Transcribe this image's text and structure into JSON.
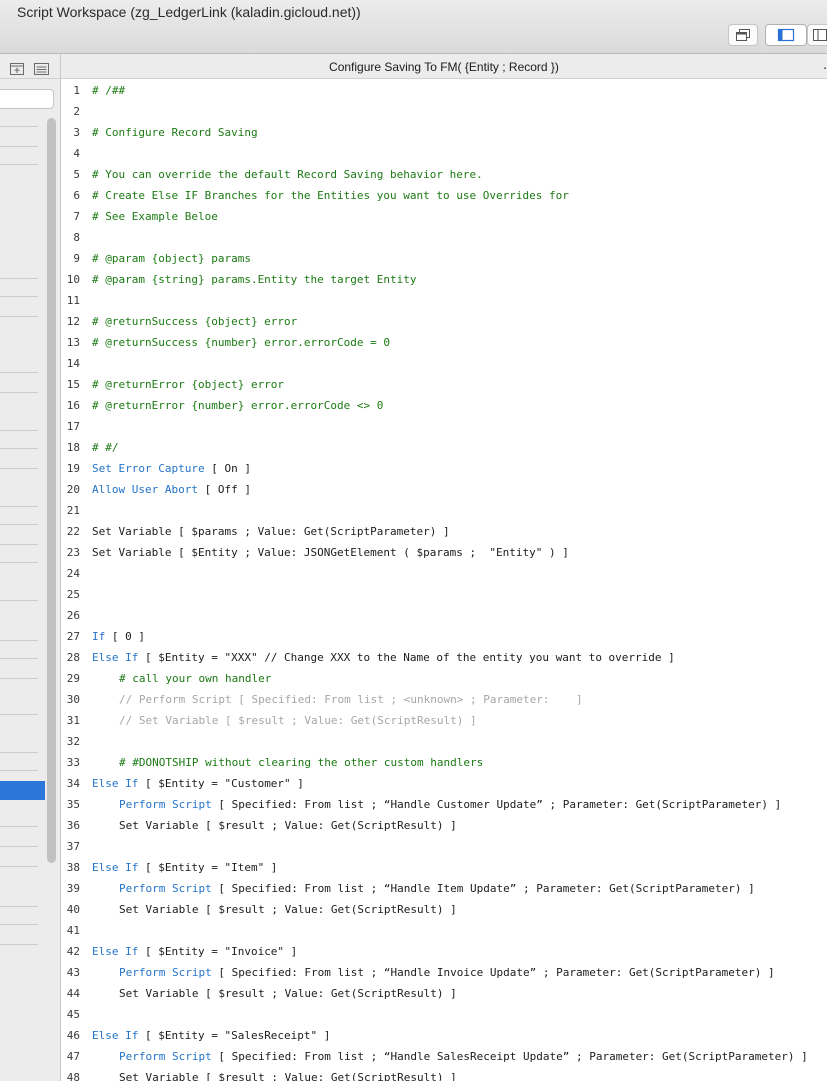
{
  "window": {
    "title": "Script Workspace (zg_LedgerLink (kaladin.gicloud.net))"
  },
  "toolbar": {
    "buttons": [
      "windows-icon",
      "panel-left-icon",
      "panel-split-icon"
    ]
  },
  "script": {
    "title": "Configure Saving To FM( {Entity ; Record })",
    "trailing": "."
  },
  "lines": [
    {
      "n": "1",
      "parts": [
        [
          "comment",
          "# /##"
        ]
      ]
    },
    {
      "n": "2",
      "parts": []
    },
    {
      "n": "3",
      "parts": [
        [
          "comment",
          "# Configure Record Saving"
        ]
      ]
    },
    {
      "n": "4",
      "parts": []
    },
    {
      "n": "5",
      "parts": [
        [
          "comment",
          "# You can override the default Record Saving behavior here."
        ]
      ]
    },
    {
      "n": "6",
      "parts": [
        [
          "comment",
          "# Create Else IF Branches for the Entities you want to use Overrides for"
        ]
      ]
    },
    {
      "n": "7",
      "parts": [
        [
          "comment",
          "# See Example Beloe"
        ]
      ]
    },
    {
      "n": "8",
      "parts": []
    },
    {
      "n": "9",
      "parts": [
        [
          "comment",
          "# @param {object} params"
        ]
      ]
    },
    {
      "n": "10",
      "parts": [
        [
          "comment",
          "# @param {string} params.Entity the target Entity"
        ]
      ]
    },
    {
      "n": "11",
      "parts": []
    },
    {
      "n": "12",
      "parts": [
        [
          "comment",
          "# @returnSuccess {object} error"
        ]
      ]
    },
    {
      "n": "13",
      "parts": [
        [
          "comment",
          "# @returnSuccess {number} error.errorCode = 0"
        ]
      ]
    },
    {
      "n": "14",
      "parts": []
    },
    {
      "n": "15",
      "parts": [
        [
          "comment",
          "# @returnError {object} error"
        ]
      ]
    },
    {
      "n": "16",
      "parts": [
        [
          "comment",
          "# @returnError {number} error.errorCode <> 0"
        ]
      ]
    },
    {
      "n": "17",
      "parts": []
    },
    {
      "n": "18",
      "parts": [
        [
          "comment",
          "# #/"
        ]
      ]
    },
    {
      "n": "19",
      "parts": [
        [
          "kw",
          "Set Error Capture"
        ],
        [
          "plain",
          " [ On ]"
        ]
      ]
    },
    {
      "n": "20",
      "parts": [
        [
          "kw",
          "Allow User Abort"
        ],
        [
          "plain",
          " [ Off ]"
        ]
      ]
    },
    {
      "n": "21",
      "parts": []
    },
    {
      "n": "22",
      "parts": [
        [
          "plain",
          "Set Variable [ $params ; Value: Get(ScriptParameter) ]"
        ]
      ]
    },
    {
      "n": "23",
      "parts": [
        [
          "plain",
          "Set Variable [ $Entity ; Value: JSONGetElement ( $params ;  \"Entity\" ) ]"
        ]
      ]
    },
    {
      "n": "24",
      "parts": []
    },
    {
      "n": "25",
      "parts": []
    },
    {
      "n": "26",
      "parts": []
    },
    {
      "n": "27",
      "parts": [
        [
          "kw",
          "If"
        ],
        [
          "plain",
          " [ 0 ]"
        ]
      ]
    },
    {
      "n": "28",
      "parts": [
        [
          "kw",
          "Else If"
        ],
        [
          "plain",
          " [ $Entity = \"XXX\" // Change XXX to the Name of the entity you want to override ]"
        ]
      ]
    },
    {
      "n": "29",
      "indent": true,
      "parts": [
        [
          "comment",
          "# call your own handler"
        ]
      ]
    },
    {
      "n": "30",
      "indent": true,
      "parts": [
        [
          "disabled",
          "// Perform Script [ Specified: From list ; <unknown> ; Parameter:    ]"
        ]
      ]
    },
    {
      "n": "31",
      "indent": true,
      "parts": [
        [
          "disabled",
          "// Set Variable [ $result ; Value: Get(ScriptResult) ]"
        ]
      ]
    },
    {
      "n": "32",
      "parts": []
    },
    {
      "n": "33",
      "indent": true,
      "parts": [
        [
          "comment",
          "# #DONOTSHIP without clearing the other custom handlers"
        ]
      ]
    },
    {
      "n": "34",
      "parts": [
        [
          "kw",
          "Else If"
        ],
        [
          "plain",
          " [ $Entity = \"Customer\" ]"
        ]
      ]
    },
    {
      "n": "35",
      "indent": true,
      "parts": [
        [
          "kw",
          "Perform Script"
        ],
        [
          "plain",
          " [ Specified: From list ; “Handle Customer Update” ; Parameter: Get(ScriptParameter) ]"
        ]
      ]
    },
    {
      "n": "36",
      "indent": true,
      "parts": [
        [
          "plain",
          "Set Variable [ $result ; Value: Get(ScriptResult) ]"
        ]
      ]
    },
    {
      "n": "37",
      "parts": []
    },
    {
      "n": "38",
      "parts": [
        [
          "kw",
          "Else If"
        ],
        [
          "plain",
          " [ $Entity = \"Item\" ]"
        ]
      ]
    },
    {
      "n": "39",
      "indent": true,
      "parts": [
        [
          "kw",
          "Perform Script"
        ],
        [
          "plain",
          " [ Specified: From list ; “Handle Item Update” ; Parameter: Get(ScriptParameter) ]"
        ]
      ]
    },
    {
      "n": "40",
      "indent": true,
      "parts": [
        [
          "plain",
          "Set Variable [ $result ; Value: Get(ScriptResult) ]"
        ]
      ]
    },
    {
      "n": "41",
      "parts": []
    },
    {
      "n": "42",
      "parts": [
        [
          "kw",
          "Else If"
        ],
        [
          "plain",
          " [ $Entity = \"Invoice\" ]"
        ]
      ]
    },
    {
      "n": "43",
      "indent": true,
      "parts": [
        [
          "kw",
          "Perform Script"
        ],
        [
          "plain",
          " [ Specified: From list ; “Handle Invoice Update” ; Parameter: Get(ScriptParameter) ]"
        ]
      ]
    },
    {
      "n": "44",
      "indent": true,
      "parts": [
        [
          "plain",
          "Set Variable [ $result ; Value: Get(ScriptResult) ]"
        ]
      ]
    },
    {
      "n": "45",
      "parts": []
    },
    {
      "n": "46",
      "parts": [
        [
          "kw",
          "Else If"
        ],
        [
          "plain",
          " [ $Entity = \"SalesReceipt\" ]"
        ]
      ]
    },
    {
      "n": "47",
      "indent": true,
      "parts": [
        [
          "kw",
          "Perform Script"
        ],
        [
          "plain",
          " [ Specified: From list ; “Handle SalesReceipt Update” ; Parameter: Get(ScriptParameter) ]"
        ]
      ]
    },
    {
      "n": "48",
      "indent": true,
      "parts": [
        [
          "plain",
          "Set Variable [ $result ; Value: Get(ScriptResult) ]"
        ]
      ]
    }
  ],
  "colors": {
    "comment": "#1c7a14",
    "keyword": "#2474c8",
    "text": "#1c1c1c",
    "disabled": "#a6a6a6",
    "selection": "#2d76d9"
  }
}
